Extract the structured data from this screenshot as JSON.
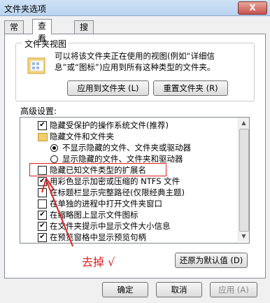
{
  "window": {
    "title": "文件夹选项",
    "close_label": "X"
  },
  "tabs": [
    {
      "label": "常规",
      "active": false
    },
    {
      "label": "查看",
      "active": true
    },
    {
      "label": "搜索",
      "active": false
    }
  ],
  "folder_view": {
    "group_label": "文件夹视图",
    "description": "可以将该文件夹正在使用的视图(例如“详细信息”或“图标”)应用到所有这种类型的文件夹。",
    "apply_button": "应用到文件夹 (L)",
    "reset_button": "重置文件夹 (R)"
  },
  "advanced": {
    "label": "高级设置:",
    "items": [
      {
        "type": "checkbox",
        "checked": true,
        "label": "隐藏受保护的操作系统文件(推荐)"
      },
      {
        "type": "folder",
        "label": "隐藏文件和文件夹"
      },
      {
        "type": "radio",
        "checked": true,
        "label": "不显示隐藏的文件、文件夹或驱动器"
      },
      {
        "type": "radio",
        "checked": false,
        "label": "显示隐藏的文件、文件夹和驱动器"
      },
      {
        "type": "checkbox",
        "checked": false,
        "label": "隐藏已知文件类型的扩展名"
      },
      {
        "type": "checkbox",
        "checked": true,
        "label": "用彩色显示加密或压缩的 NTFS 文件"
      },
      {
        "type": "checkbox",
        "checked": false,
        "label": "在标题栏显示完整路径(仅限经典主题)"
      },
      {
        "type": "checkbox",
        "checked": false,
        "label": "在单独的进程中打开文件夹窗口"
      },
      {
        "type": "checkbox",
        "checked": true,
        "label": "在缩略图上显示文件图标"
      },
      {
        "type": "checkbox",
        "checked": true,
        "label": "在文件夹提示中显示文件大小信息"
      },
      {
        "type": "checkbox",
        "checked": true,
        "label": "在预览窗格中显示预览句柄"
      }
    ],
    "restore_button": "还原为默认值 (D)"
  },
  "annotation": {
    "text": "去掉 √",
    "color": "#e02020"
  },
  "footer": {
    "ok": "确定",
    "cancel": "取消",
    "apply": "应用 (A)"
  }
}
